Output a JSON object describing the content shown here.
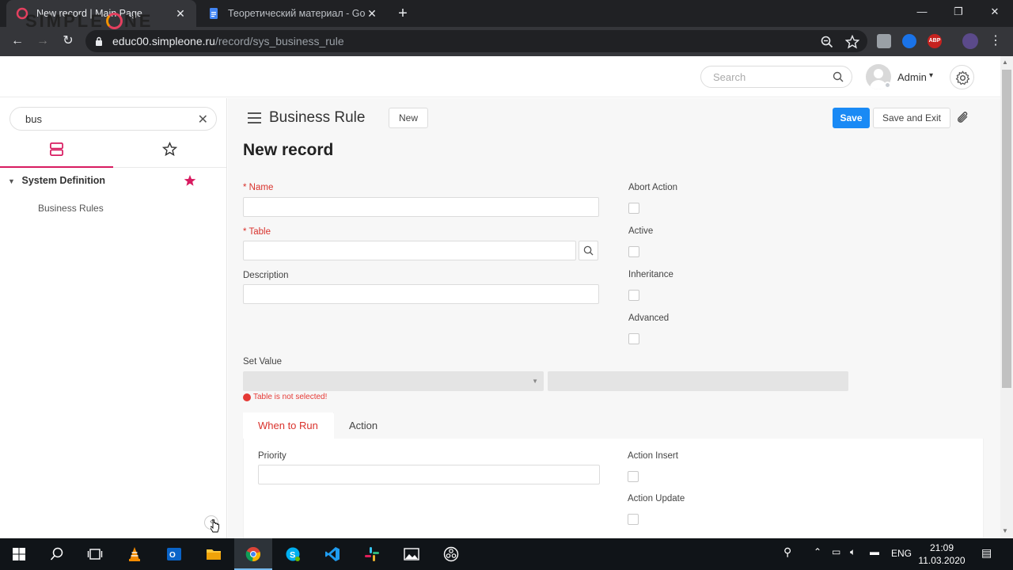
{
  "browser": {
    "tabs": [
      {
        "title": "New record | Main Page",
        "active": true
      },
      {
        "title": "Теоретический материал - Goo",
        "active": false
      }
    ],
    "url_host": "educ00.simpleone.ru",
    "url_path": "/record/sys_business_rule"
  },
  "app": {
    "logo_left": "SIMPLE",
    "logo_right": "NE",
    "search_placeholder": "Search",
    "user_name": "Admin"
  },
  "sidebar": {
    "search_value": "bus",
    "group_label": "System Definition",
    "items": [
      {
        "label": "Business Rules"
      }
    ]
  },
  "form": {
    "title": "Business Rule",
    "new_label": "New",
    "save_label": "Save",
    "save_exit_label": "Save and Exit",
    "record_title": "New record",
    "fields": {
      "name_label": "Name",
      "table_label": "Table",
      "description_label": "Description",
      "abort_action_label": "Abort Action",
      "active_label": "Active",
      "inheritance_label": "Inheritance",
      "advanced_label": "Advanced",
      "set_value_label": "Set Value",
      "set_value_error": "Table is not selected!"
    },
    "tabs": [
      {
        "label": "When to Run",
        "active": true
      },
      {
        "label": "Action",
        "active": false
      }
    ],
    "when_to_run": {
      "priority_label": "Priority",
      "action_insert_label": "Action Insert",
      "action_update_label": "Action Update"
    }
  },
  "taskbar": {
    "language": "ENG",
    "time": "21:09",
    "date": "11.03.2020"
  },
  "colors": {
    "accent": "#d81b60",
    "primary_button": "#1a8af5",
    "required": "#d9322c",
    "error": "#e53935"
  }
}
